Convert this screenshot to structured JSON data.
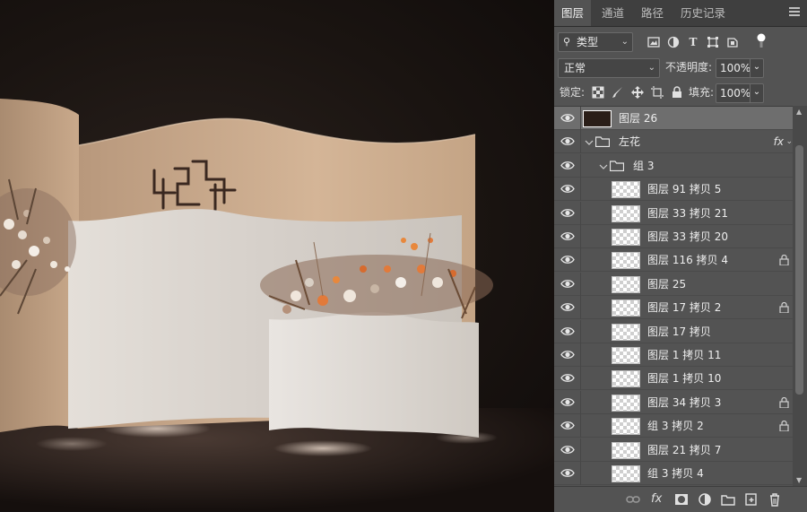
{
  "tabs": [
    "图层",
    "通道",
    "路径",
    "历史记录"
  ],
  "filter": {
    "label": "类型"
  },
  "blend": {
    "mode": "正常",
    "opacity_label": "不透明度:",
    "opacity_value": "100%"
  },
  "lock": {
    "label": "锁定:",
    "fill_label": "填充:",
    "fill_value": "100%"
  },
  "layers": [
    {
      "name": "图层 26",
      "type": "layer",
      "thumb": "photo",
      "selected": true,
      "indent": 0
    },
    {
      "name": "左花",
      "type": "group",
      "expanded": true,
      "fx": "fx",
      "indent": 0
    },
    {
      "name": "组 3",
      "type": "group",
      "expanded": true,
      "indent": 1
    },
    {
      "name": "图层 91 拷贝 5",
      "type": "layer",
      "indent": 2
    },
    {
      "name": "图层 33 拷贝 21",
      "type": "layer",
      "indent": 2
    },
    {
      "name": "图层 33 拷贝 20",
      "type": "layer",
      "indent": 2
    },
    {
      "name": "图层 116 拷贝 4",
      "type": "layer",
      "indent": 2,
      "locked": true
    },
    {
      "name": "图层 25",
      "type": "layer",
      "indent": 2
    },
    {
      "name": "图层 17 拷贝 2",
      "type": "layer",
      "indent": 2,
      "locked": true
    },
    {
      "name": "图层 17 拷贝",
      "type": "layer",
      "indent": 2
    },
    {
      "name": "图层 1 拷贝 11",
      "type": "layer",
      "indent": 2
    },
    {
      "name": "图层 1 拷贝 10",
      "type": "layer",
      "indent": 2
    },
    {
      "name": "图层 34 拷贝 3",
      "type": "layer",
      "indent": 2,
      "locked": true
    },
    {
      "name": "组 3 拷贝 2",
      "type": "layer",
      "indent": 2,
      "locked": true
    },
    {
      "name": "图层 21 拷贝 7",
      "type": "layer",
      "indent": 2
    },
    {
      "name": "组 3 拷贝 4",
      "type": "layer",
      "indent": 2
    }
  ],
  "filter_icons": [
    "image-filter-icon",
    "adjustment-filter-icon",
    "type-filter-icon",
    "shape-filter-icon",
    "smart-object-filter-icon",
    "filter-toggle-icon"
  ],
  "lock_icons": [
    "lock-transparent-icon",
    "lock-paint-icon",
    "lock-move-icon",
    "lock-artboard-icon",
    "lock-all-icon"
  ],
  "bottom_icons": [
    "link-layers-icon",
    "add-style-icon",
    "add-mask-icon",
    "new-adjustment-icon",
    "new-group-icon",
    "new-layer-icon",
    "delete-layer-icon"
  ],
  "colors": {
    "panel_bg": "#535353",
    "tab_bar": "#3f3f3f",
    "selected_row": "#6e6e6e",
    "canvas_bg": "#1a1411",
    "backdrop": "#c8a98c"
  }
}
